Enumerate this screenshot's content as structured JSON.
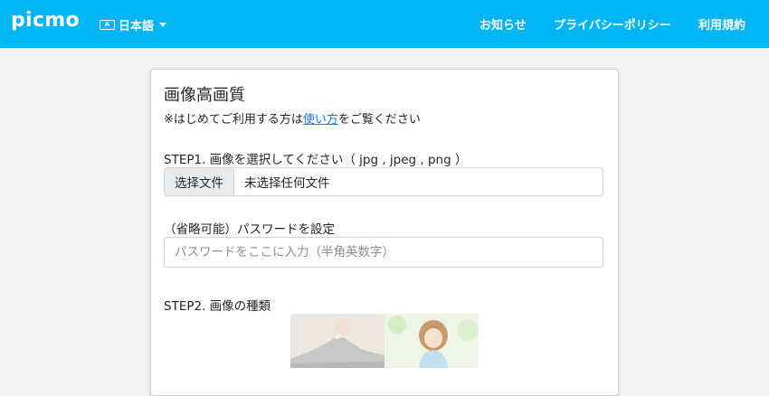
{
  "navbar": {
    "brand": "picmo",
    "language": {
      "icon": "language-icon",
      "label": "日本語"
    },
    "links": {
      "news": "お知らせ",
      "privacy": "プライバシーポリシー",
      "terms": "利用規約"
    }
  },
  "card": {
    "title": "画像高画質",
    "note": {
      "prefix": "※はじめてご利用する方は",
      "link": "使い方",
      "suffix": "をご覧ください"
    },
    "step1_label": "STEP1. 画像を選択してください（ jpg , jpeg , png ）",
    "file_input": {
      "button": "选择文件",
      "value": "未选择任何文件"
    },
    "password": {
      "label": "（省略可能）パスワードを設定",
      "placeholder": "パスワードをここに入力（半角英数字）"
    },
    "step2_label": "STEP2. 画像の種類"
  },
  "colors": {
    "navbar": "#02b5f5",
    "link": "#1a73e8",
    "page_bg": "#f2f2f2"
  }
}
